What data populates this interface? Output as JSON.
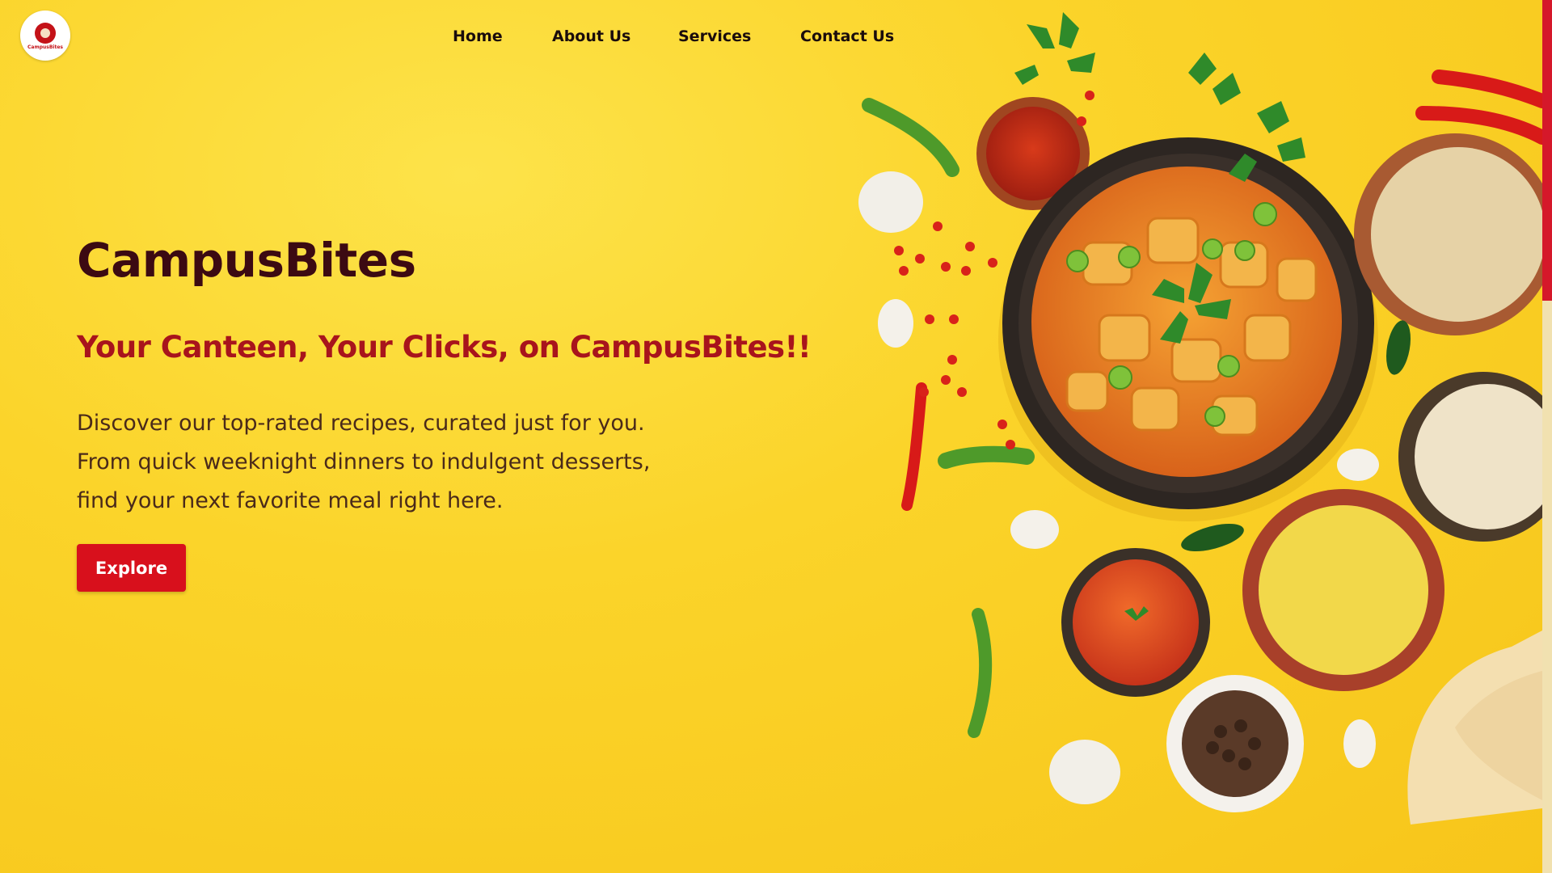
{
  "brand": {
    "logo_text": "CampusBites"
  },
  "nav": {
    "items": [
      "Home",
      "About Us",
      "Services",
      "Contact Us"
    ]
  },
  "hero": {
    "title": "CampusBites",
    "tagline": "Your Canteen, Your Clicks, on CampusBites!!",
    "description_lines": [
      "Discover our top-rated recipes, curated just for you.",
      "From quick weeknight dinners to indulgent desserts,",
      "find your next favorite meal right here."
    ],
    "cta_label": "Explore"
  },
  "colors": {
    "background": "#fbd42a",
    "title": "#3c0a12",
    "tagline": "#a8141c",
    "button": "#d8101c",
    "scroll_thumb": "#d5182a"
  },
  "icons": [
    "chef-logo-icon"
  ]
}
